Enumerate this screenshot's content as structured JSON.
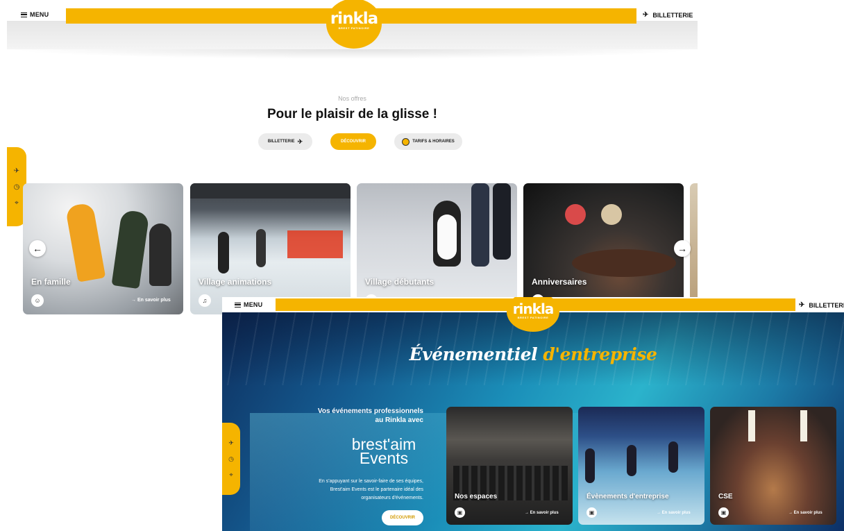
{
  "shot1": {
    "header": {
      "menu_label": "MENU",
      "billetterie_label": "BILLETTERIE"
    },
    "logo": {
      "word": "rinkla",
      "sub": "BREST PATINOIRE"
    },
    "section": {
      "kicker": "Nos offres",
      "title": "Pour le plaisir de la glisse !"
    },
    "tabs": [
      {
        "label": "BILLETTERIE",
        "active": false
      },
      {
        "label": "DÉCOUVRIR",
        "active": true
      },
      {
        "label": "TARIFS & HORAIRES",
        "active": false
      }
    ],
    "cards": [
      {
        "label": "En famille",
        "more": "→ En savoir plus",
        "icon": "family-icon"
      },
      {
        "label": "Village animations",
        "icon": "music-icon"
      },
      {
        "label": "Village débutants",
        "icon": "skate-icon"
      },
      {
        "label": "Anniversaires",
        "icon": "cake-icon"
      }
    ]
  },
  "shot2": {
    "header": {
      "menu_label": "MENU",
      "billetterie_label": "BILLETTERIE"
    },
    "logo": {
      "word": "rinkla",
      "sub": "BREST PATINOIRE"
    },
    "title_white": "Événementiel",
    "title_yellow": "d'entreprise",
    "intro": [
      "Vos événements professionnels",
      "au Rinkla avec"
    ],
    "brand_line1": "brest'aim",
    "brand_line2": "Events",
    "description": [
      "En s'appuyant sur le savoir-faire de ses équipes,",
      "Brest'aim Events est le partenaire idéal des",
      "organisateurs d'événements."
    ],
    "cta": "DÉCOUVRIR",
    "cards": [
      {
        "label": "Nos espaces",
        "more": "→ En savoir plus"
      },
      {
        "label": "Évènements d'entreprise",
        "more": "→ En savoir plus"
      },
      {
        "label": "CSE",
        "more": "→ En savoir plus"
      }
    ]
  },
  "colors": {
    "brand_yellow": "#f5b400"
  }
}
